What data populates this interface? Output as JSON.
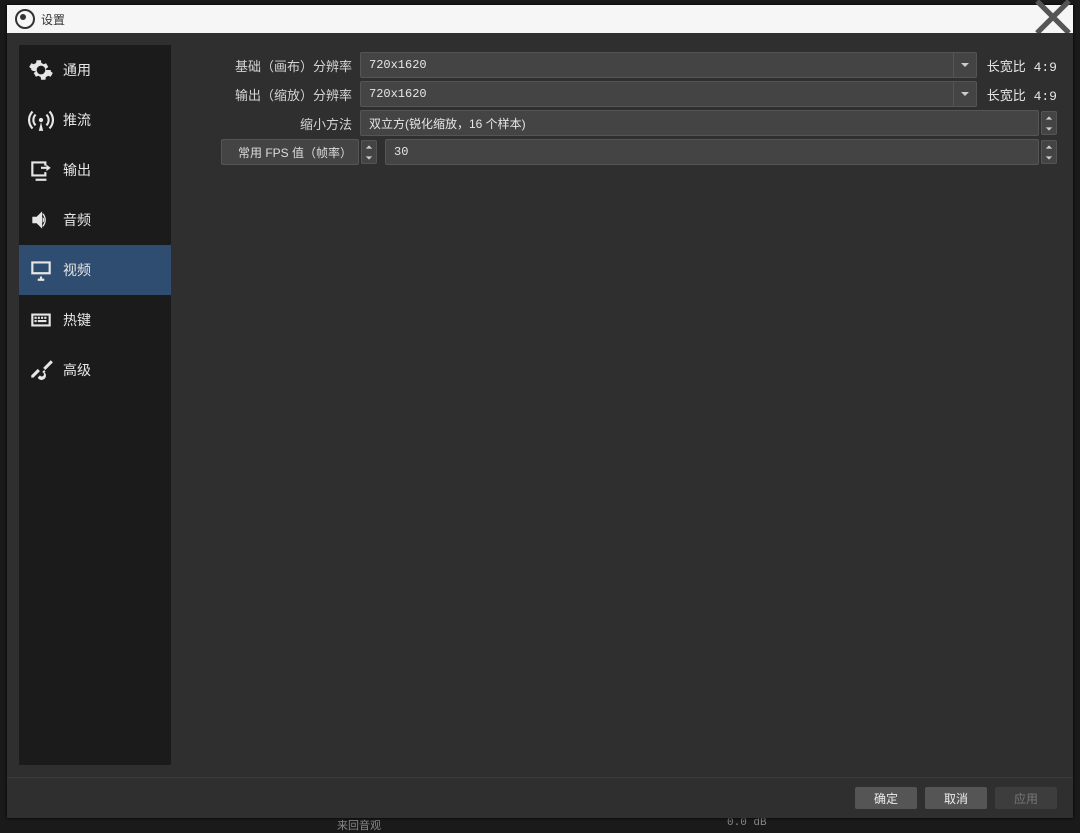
{
  "window": {
    "title": "设置"
  },
  "sidebar": {
    "items": [
      {
        "label": "通用"
      },
      {
        "label": "推流"
      },
      {
        "label": "输出"
      },
      {
        "label": "音频"
      },
      {
        "label": "视频"
      },
      {
        "label": "热键"
      },
      {
        "label": "高级"
      }
    ],
    "active_index": 4
  },
  "video": {
    "base_label": "基础（画布）分辨率",
    "base_value": "720x1620",
    "base_aspect": "长宽比 4:9",
    "output_label": "输出（缩放）分辨率",
    "output_value": "720x1620",
    "output_aspect": "长宽比 4:9",
    "downscale_label": "缩小方法",
    "downscale_value": "双立方(锐化缩放，16 个样本)",
    "fps_label": "常用 FPS 值（帧率）",
    "fps_value": "30"
  },
  "footer": {
    "ok": "确定",
    "cancel": "取消",
    "apply": "应用"
  },
  "bg": {
    "left": "来回音观",
    "right": "0.0 dB"
  }
}
